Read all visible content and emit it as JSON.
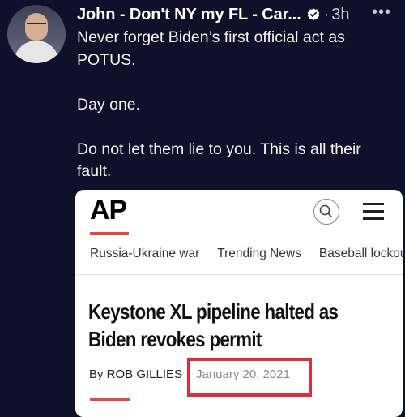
{
  "tweet": {
    "display_name": "John - Don't NY my FL - Car...",
    "separator": "·",
    "time": "3h",
    "more": "•••",
    "text_lines": [
      "Never forget Biden’s first official act as",
      "POTUS.",
      "Day one.",
      "Do not let them lie to you. This is all their",
      "fault."
    ]
  },
  "card": {
    "logo": "AP",
    "nav": [
      "Russia-Ukraine war",
      "Trending News",
      "Baseball lockou"
    ],
    "headline_lines": [
      "Keystone XL pipeline halted as",
      "Biden revokes permit"
    ],
    "byline": "By ROB GILLIES",
    "date": "January 20, 2021"
  },
  "colors": {
    "background": "#0f1029",
    "verified": "#ffffff",
    "ap_red": "#e5483f",
    "highlight": "#e02b3c"
  },
  "icons": {
    "verified": "verified-badge-icon",
    "search": "search-icon",
    "menu": "hamburger-menu-icon",
    "more": "more-dots-icon"
  }
}
